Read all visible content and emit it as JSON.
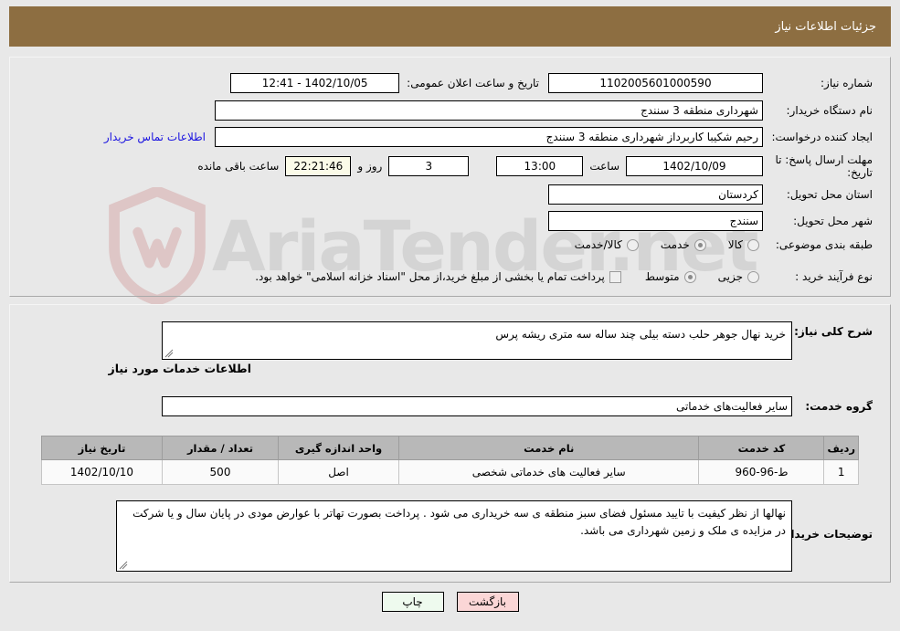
{
  "header": {
    "title": "جزئیات اطلاعات نیاز",
    "bar_color": "#8d6e41"
  },
  "watermark": {
    "text": "AriaTender.net"
  },
  "info": {
    "need_number_label": "شماره نیاز:",
    "need_number_value": "1102005601000590",
    "announce_label": "تاریخ و ساعت اعلان عمومی:",
    "announce_value": "1402/10/05 - 12:41",
    "buyer_org_label": "نام دستگاه خریدار:",
    "buyer_org_value": "شهرداری منطقه 3 سنندج",
    "requester_label": "ایجاد کننده درخواست:",
    "requester_value": "رحیم شکیبا کاربرداز شهرداری منطقه 3 سنندج",
    "contact_link": "اطلاعات تماس خریدار",
    "deadline_label": "مهلت ارسال پاسخ: تا تاریخ:",
    "deadline_date": "1402/10/09",
    "deadline_hour_label": "ساعت",
    "deadline_hour_value": "13:00",
    "remaining_days": "3",
    "remaining_days_label": "روز و",
    "remaining_time": "22:21:46",
    "remaining_suffix": "ساعت باقی مانده",
    "province_label": "استان محل تحویل:",
    "province_value": "کردستان",
    "city_label": "شهر محل تحویل:",
    "city_value": "سنندج",
    "category_label": "طبقه بندی موضوعی:",
    "category_options": [
      {
        "label": "کالا",
        "selected": false
      },
      {
        "label": "خدمت",
        "selected": true
      },
      {
        "label": "کالا/خدمت",
        "selected": false
      }
    ],
    "process_label": "نوع فرآیند خرید :",
    "process_options": [
      {
        "label": "جزیی",
        "selected": false
      },
      {
        "label": "متوسط",
        "selected": true
      }
    ],
    "treasury_checkbox_checked": false,
    "treasury_note": "پرداخت تمام یا بخشی از مبلغ خرید،از محل \"اسناد خزانه اسلامی\" خواهد بود."
  },
  "needs": {
    "summary_label": "شرح کلی نیاز:",
    "summary_value": "خرید نهال جوهر حلب دسته بیلی چند ساله سه متری ریشه پرس",
    "section_heading": "اطلاعات خدمات مورد نیاز",
    "service_group_label": "گروه خدمت:",
    "service_group_value": "سایر فعالیت‌های خدماتی"
  },
  "table": {
    "columns": [
      "ردیف",
      "کد خدمت",
      "نام خدمت",
      "واحد اندازه گیری",
      "تعداد / مقدار",
      "تاریخ نیاز"
    ],
    "rows": [
      {
        "index": "1",
        "code": "ط-96-960",
        "name": "سایر فعالیت های خدماتی شخصی",
        "unit": "اصل",
        "quantity": "500",
        "need_date": "1402/10/10"
      }
    ]
  },
  "buyer_notes": {
    "label": "توضیحات خریدار:",
    "value": "نهالها از نظر کیفیت با تایید مسئول فضای سبز منطقه ی سه خریداری می شود . پرداخت بصورت تهاتر با عوارض مودی در پایان سال و یا شرکت در مزایده ی ملک و زمین شهرداری می باشد."
  },
  "buttons": {
    "print": "چاپ",
    "back": "بازگشت"
  }
}
